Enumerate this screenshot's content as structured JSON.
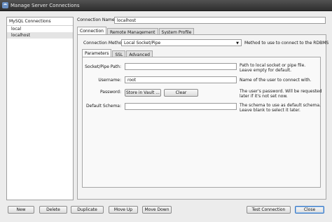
{
  "window": {
    "title": "Manage Server Connections"
  },
  "sidebar": {
    "header": "MySQL Connections",
    "items": [
      "local",
      "localhost"
    ]
  },
  "connection_name": {
    "label": "Connection Name:",
    "value": "localhost"
  },
  "tabs": [
    "Connection",
    "Remote Management",
    "System Profile"
  ],
  "method": {
    "label": "Connection Method:",
    "value": "Local Socket/Pipe",
    "description": "Method to use to connect to the RDBMS"
  },
  "subtabs": [
    "Parameters",
    "SSL",
    "Advanced"
  ],
  "params": {
    "socket_label": "Socket/Pipe Path:",
    "socket_value": "",
    "socket_desc_1": "Path to local socket or pipe file.",
    "socket_desc_2": "Leave empty for default.",
    "username_label": "Username:",
    "username_value": "root",
    "username_desc": "Name of the user to connect with.",
    "password_label": "Password:",
    "store_label": "Store in Vault ...",
    "clear_label": "Clear",
    "password_desc_1": "The user's password. Will be requested",
    "password_desc_2": "later if it's not set now.",
    "schema_label": "Default Schema:",
    "schema_value": "",
    "schema_desc_1": "The schema to use as default schema.",
    "schema_desc_2": "Leave blank to select it later."
  },
  "buttons": {
    "new": "New",
    "delete": "Delete",
    "duplicate": "Duplicate",
    "move_up": "Move Up",
    "move_down": "Move Down",
    "test": "Test Connection",
    "close": "Close"
  }
}
